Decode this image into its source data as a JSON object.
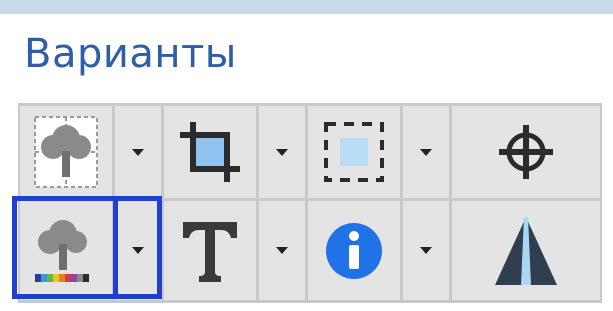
{
  "panel": {
    "title": "Варианты"
  },
  "toolbar": {
    "row1": [
      {
        "name": "raster-tree-grid-button",
        "icon": "raster-tree-grid-icon",
        "has_dropdown": true
      },
      {
        "name": "crop-button",
        "icon": "crop-icon",
        "has_dropdown": true
      },
      {
        "name": "selection-marquee-button",
        "icon": "selection-marquee-icon",
        "has_dropdown": true
      },
      {
        "name": "crosshair-button",
        "icon": "crosshair-icon",
        "has_dropdown": false
      }
    ],
    "row2": [
      {
        "name": "colorized-tree-button",
        "icon": "colorized-tree-icon",
        "has_dropdown": true,
        "highlighted": true
      },
      {
        "name": "text-button",
        "icon": "text-T-icon",
        "has_dropdown": true
      },
      {
        "name": "info-button",
        "icon": "info-icon",
        "has_dropdown": true
      },
      {
        "name": "perspective-button",
        "icon": "perspective-icon",
        "has_dropdown": false
      }
    ]
  },
  "colors": {
    "title": "#2d5ea6",
    "highlight": "#1f3fcf",
    "button_face": "#e4e4e4",
    "separator": "#c9c9c9",
    "info_blue": "#1f73e6",
    "crop_blue": "#8fc4f0"
  }
}
